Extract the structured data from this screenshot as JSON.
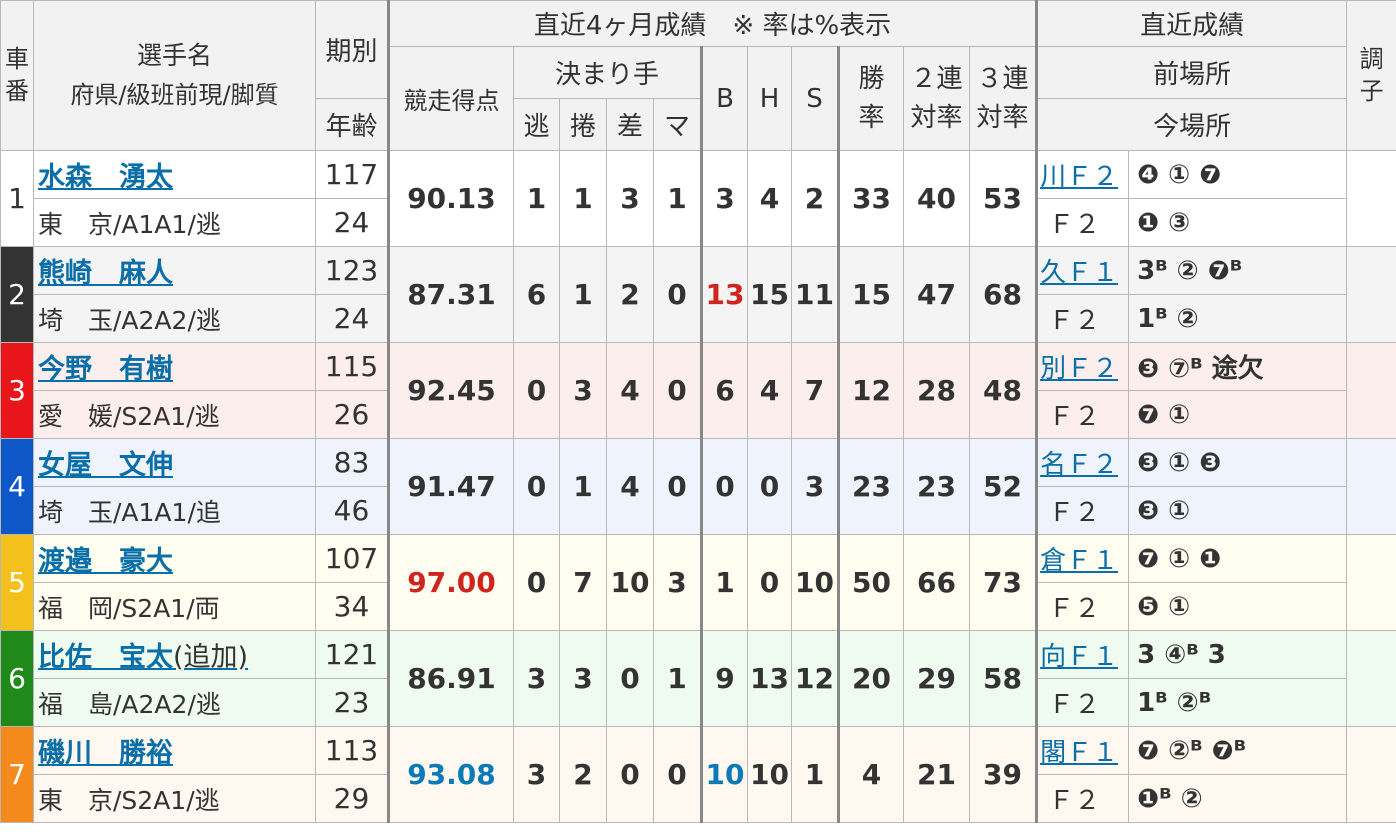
{
  "header": {
    "car_no": "車番",
    "name": "選手名",
    "pref_class": "府県/級班前現/脚質",
    "term": "期別",
    "age": "年齢",
    "recent4": "直近4ヶ月成績　※ 率は%表示",
    "score": "競走得点",
    "kimarite": "決まり手",
    "nige": "逃",
    "makuri": "捲",
    "sashi": "差",
    "mark": "マ",
    "b": "B",
    "h": "H",
    "s": "S",
    "win": "勝率",
    "rentai2": "２連対率",
    "rentai3": "３連対率",
    "recent": "直近成績",
    "prev_venue": "前場所",
    "this_venue": "今場所",
    "condition": "調子"
  },
  "colors": [
    "#ffffff",
    "#333333",
    "#e8161a",
    "#0d57c8",
    "#f3c01c",
    "#1f8a1a",
    "#f48a1c"
  ],
  "riders": [
    {
      "car": "1",
      "name": "水森　湧太",
      "extra": "",
      "pref": "東　京/A1A1/逃",
      "term": "117",
      "age": "24",
      "score": "90.13",
      "nige": "1",
      "makuri": "1",
      "sashi": "3",
      "mark": "1",
      "b": "3",
      "h": "4",
      "s": "2",
      "win": "33",
      "r2": "40",
      "r3": "53",
      "prev": "川Ｆ２",
      "prev_res": "❹ ① ❼",
      "this": "Ｆ２",
      "this_res": "❶ ③"
    },
    {
      "car": "2",
      "name": "熊崎　麻人",
      "extra": "",
      "pref": "埼　玉/A2A2/逃",
      "term": "123",
      "age": "24",
      "score": "87.31",
      "nige": "6",
      "makuri": "1",
      "sashi": "2",
      "mark": "0",
      "b": "13",
      "h": "15",
      "s": "11",
      "win": "15",
      "r2": "47",
      "r3": "68",
      "prev": "久Ｆ１",
      "prev_res": "3ᴮ ② ❼ᴮ",
      "this": "Ｆ２",
      "this_res": "1ᴮ ②"
    },
    {
      "car": "3",
      "name": "今野　有樹",
      "extra": "",
      "pref": "愛　媛/S2A1/逃",
      "term": "115",
      "age": "26",
      "score": "92.45",
      "nige": "0",
      "makuri": "3",
      "sashi": "4",
      "mark": "0",
      "b": "6",
      "h": "4",
      "s": "7",
      "win": "12",
      "r2": "28",
      "r3": "48",
      "prev": "別Ｆ２",
      "prev_res": "❸ ⑦ᴮ 途欠",
      "this": "Ｆ２",
      "this_res": "❼ ①"
    },
    {
      "car": "4",
      "name": "女屋　文伸",
      "extra": "",
      "pref": "埼　玉/A1A1/追",
      "term": "83",
      "age": "46",
      "score": "91.47",
      "nige": "0",
      "makuri": "1",
      "sashi": "4",
      "mark": "0",
      "b": "0",
      "h": "0",
      "s": "3",
      "win": "23",
      "r2": "23",
      "r3": "52",
      "prev": "名Ｆ２",
      "prev_res": "❸ ① ❸",
      "this": "Ｆ２",
      "this_res": "❸ ①"
    },
    {
      "car": "5",
      "name": "渡邉　豪大",
      "extra": "",
      "pref": "福　岡/S2A1/両",
      "term": "107",
      "age": "34",
      "score": "97.00",
      "nige": "0",
      "makuri": "7",
      "sashi": "10",
      "mark": "3",
      "b": "1",
      "h": "0",
      "s": "10",
      "win": "50",
      "r2": "66",
      "r3": "73",
      "prev": "倉Ｆ１",
      "prev_res": "❼ ① ❶",
      "this": "Ｆ２",
      "this_res": "❺ ①"
    },
    {
      "car": "6",
      "name": "比佐　宝太",
      "extra": "(追加)",
      "pref": "福　島/A2A2/逃",
      "term": "121",
      "age": "23",
      "score": "86.91",
      "nige": "3",
      "makuri": "3",
      "sashi": "0",
      "mark": "1",
      "b": "9",
      "h": "13",
      "s": "12",
      "win": "20",
      "r2": "29",
      "r3": "58",
      "prev": "向Ｆ１",
      "prev_res": "3 ④ᴮ 3",
      "this": "Ｆ２",
      "this_res": "1ᴮ ②ᴮ"
    },
    {
      "car": "7",
      "name": "磯川　勝裕",
      "extra": "",
      "pref": "東　京/S2A1/逃",
      "term": "113",
      "age": "29",
      "score": "93.08",
      "nige": "3",
      "makuri": "2",
      "sashi": "0",
      "mark": "0",
      "b": "10",
      "h": "10",
      "s": "1",
      "win": "4",
      "r2": "21",
      "r3": "39",
      "prev": "閣Ｆ１",
      "prev_res": "❼ ②ᴮ ❼ᴮ",
      "this": "Ｆ２",
      "this_res": "❶ᴮ ②"
    }
  ]
}
